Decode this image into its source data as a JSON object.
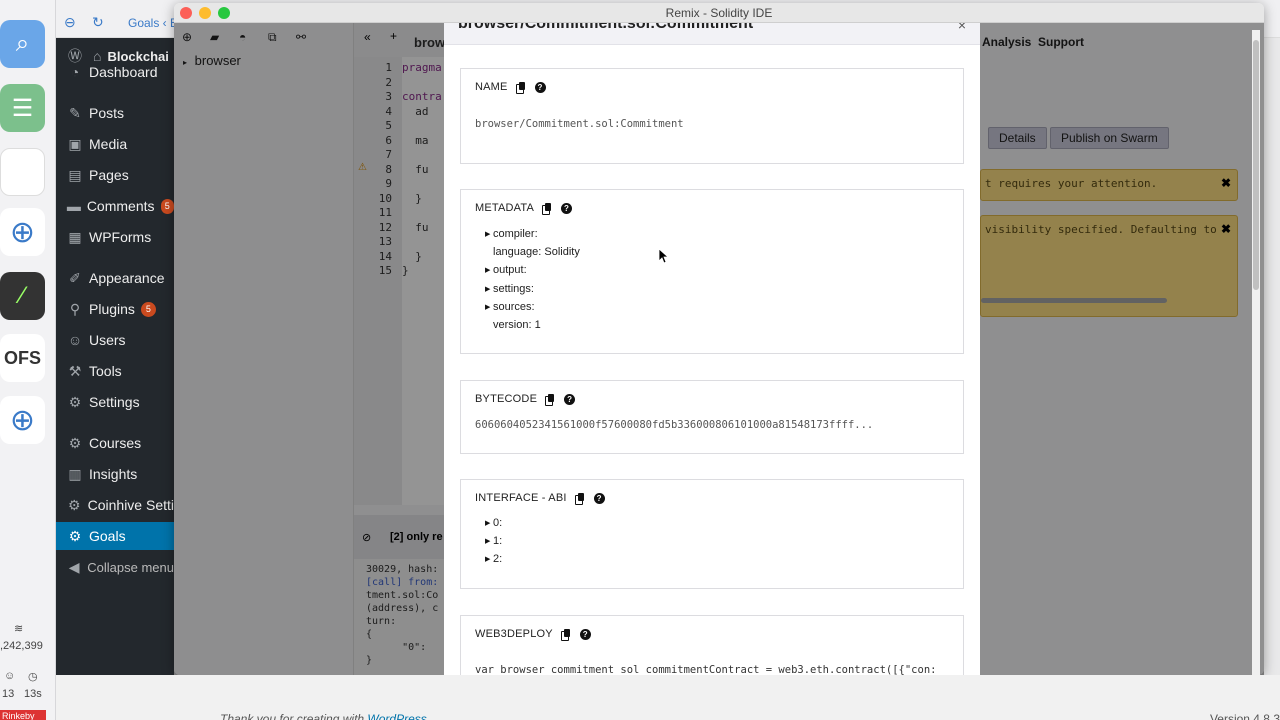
{
  "window": {
    "title": "Remix - Solidity IDE"
  },
  "browser": {
    "tab_label": "Goals ‹ Blo"
  },
  "wp_menu": {
    "site": "Blockchai",
    "items": [
      {
        "label": "Dashboard",
        "icon": "dashboard-icon",
        "glyph": "◔"
      },
      {
        "label": "Posts",
        "icon": "pin-icon",
        "glyph": "✎"
      },
      {
        "label": "Media",
        "icon": "media-icon",
        "glyph": "▣"
      },
      {
        "label": "Pages",
        "icon": "pages-icon",
        "glyph": "▤"
      },
      {
        "label": "Comments",
        "icon": "comments-icon",
        "glyph": "▬",
        "badge": "5"
      },
      {
        "label": "WPForms",
        "icon": "forms-icon",
        "glyph": "▦"
      },
      {
        "label": "Appearance",
        "icon": "brush-icon",
        "glyph": "✐"
      },
      {
        "label": "Plugins",
        "icon": "plug-icon",
        "glyph": "⚲",
        "badge": "5"
      },
      {
        "label": "Users",
        "icon": "users-icon",
        "glyph": "☺"
      },
      {
        "label": "Tools",
        "icon": "wrench-icon",
        "glyph": "⚒"
      },
      {
        "label": "Settings",
        "icon": "sliders-icon",
        "glyph": "⚙"
      },
      {
        "label": "Courses",
        "icon": "gear-icon",
        "glyph": "⚙"
      },
      {
        "label": "Insights",
        "icon": "chart-icon",
        "glyph": "▥"
      },
      {
        "label": "Coinhive Setti",
        "icon": "gear-icon",
        "glyph": "⚙"
      },
      {
        "label": "Goals",
        "icon": "gear-icon",
        "glyph": "⚙",
        "active": true
      },
      {
        "label": "Collapse menu",
        "icon": "collapse-icon",
        "glyph": "◀"
      }
    ]
  },
  "dock": {
    "stat_value": ",242,399",
    "stat_a": "13",
    "stat_b": "13s",
    "pinkeby": "Rinkeby",
    "ofs": "OFS"
  },
  "remix": {
    "file_tree_root": "browser",
    "editor_tab": "brow",
    "line_numbers": [
      "1",
      "2",
      "3",
      "4",
      "5",
      "6",
      "7",
      "8",
      "9",
      "10",
      "11",
      "12",
      "13",
      "14",
      "15"
    ],
    "code": [
      "pragma",
      "",
      "contra",
      "  ad",
      "",
      "  ma",
      "",
      "  fu",
      "",
      "  }",
      "",
      "  fu",
      "",
      "  }",
      "}"
    ],
    "terminal_filter": "[2] only re",
    "terminal_lines": [
      "30029, hash:",
      "",
      "[call] from:",
      "tment.sol:Co",
      "(address), c",
      "turn:",
      "{",
      "      \"0\":",
      "",
      "}"
    ],
    "right_tabs": [
      "Analysis",
      "Support"
    ],
    "buttons": [
      "Details",
      "Publish on Swarm"
    ],
    "warning1": "t requires your attention.",
    "warning2": " visibility specified. Defaulting to"
  },
  "modal": {
    "title": "browser/Commitment.sol:Commitment",
    "close": "×",
    "name": {
      "heading": "NAME",
      "value": "browser/Commitment.sol:Commitment"
    },
    "metadata": {
      "heading": "METADATA",
      "rows": [
        {
          "label": "compiler:",
          "expandable": true
        },
        {
          "label": "language: Solidity",
          "expandable": false
        },
        {
          "label": "output:",
          "expandable": true
        },
        {
          "label": "settings:",
          "expandable": true
        },
        {
          "label": "sources:",
          "expandable": true
        },
        {
          "label": "version: 1",
          "expandable": false
        }
      ]
    },
    "bytecode": {
      "heading": "BYTECODE",
      "value": "6060604052341561000f57600080fd5b336000806101000a81548173ffff..."
    },
    "abi": {
      "heading": "INTERFACE - ABI",
      "rows": [
        "0:",
        "1:",
        "2:"
      ]
    },
    "web3deploy": {
      "heading": "WEB3DEPLOY",
      "value": "var browser_commitment_sol_commitmentContract = web3.eth.contract([{\"con:"
    }
  },
  "footer": {
    "thanks": "Thank you for creating with",
    "wordpress": "WordPress",
    "version": "Version 4.8.3"
  },
  "colors": {
    "wp_sidebar": "#23282d",
    "wp_active": "#0073aa",
    "warning_bg": "#ffe184"
  }
}
